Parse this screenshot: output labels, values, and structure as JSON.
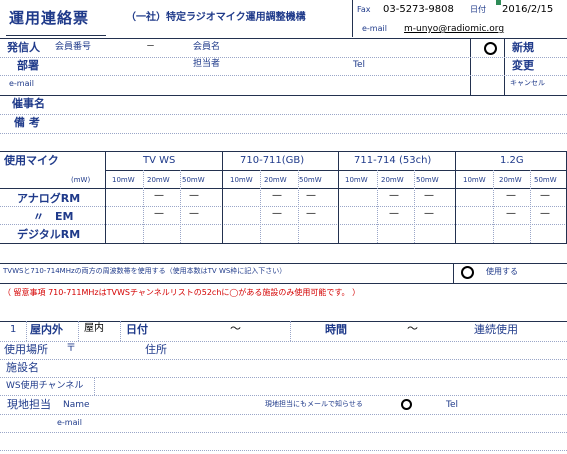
{
  "header": {
    "title": "運用連絡票",
    "org": "（一社）特定ラジオマイク運用調整機構",
    "fax_label": "Fax",
    "fax": "03-5273-9808",
    "date_label": "日付",
    "date": "2016/2/15",
    "email_label": "e-mail",
    "email": "m-unyo@radiomic.org"
  },
  "applicant": {
    "sender_label": "発信人",
    "member_no_label": "会員番号",
    "dash": "－",
    "member_name_label": "会員名",
    "dept_label": "部署",
    "contact_label": "担当者",
    "tel_label": "Tel",
    "email_label": "e-mail",
    "new_label": "新規",
    "change_label": "変更",
    "cancel_label": "キャンセル",
    "event_label": "催事名",
    "notes_label": "備 考"
  },
  "mics": {
    "header_label": "使用マイク",
    "unit_label": "(mW)",
    "bands": [
      "TV WS",
      "710-711(GB)",
      "711-714 (53ch)",
      "1.2G"
    ],
    "powers": [
      "10mW",
      "20mW",
      "50mW"
    ],
    "rows": [
      "アナログRM",
      "〃　EM",
      "デジタルRM"
    ],
    "dash": "—"
  },
  "tvws_note": {
    "text": "TVWSと710-714MHzの両方の周波数帯を使用する（使用本数はTV WS枠に記入下さい）",
    "use_label": "使用する"
  },
  "warning": "（ 留意事項 710-711MHzはTVWSチャンネルリストの52chに◯がある施設のみ使用可能です。 ）",
  "venue": {
    "no": "1",
    "inout_label": "屋内外",
    "inout_value": "屋内",
    "date_label": "日付",
    "tilde": "～",
    "time_label": "時間",
    "continuous_label": "連続使用",
    "place_label": "使用場所",
    "postal": "〒",
    "address_label": "住所",
    "facility_label": "施設名",
    "ws_channel_label": "WS使用チャンネル",
    "onsite_label": "現地担当",
    "name_label": "Name",
    "onsite_mail_note": "現地担当にもメールで知らせる",
    "tel_label": "Tel",
    "email_label": "e-mail"
  }
}
